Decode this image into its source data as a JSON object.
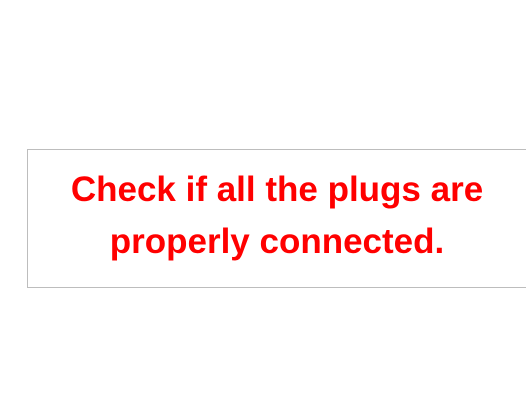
{
  "message": {
    "line1": "Check if all the plugs are",
    "line2": "properly connected."
  },
  "colors": {
    "text": "#ff0000",
    "border": "#bdbdbd",
    "background": "#ffffff"
  }
}
